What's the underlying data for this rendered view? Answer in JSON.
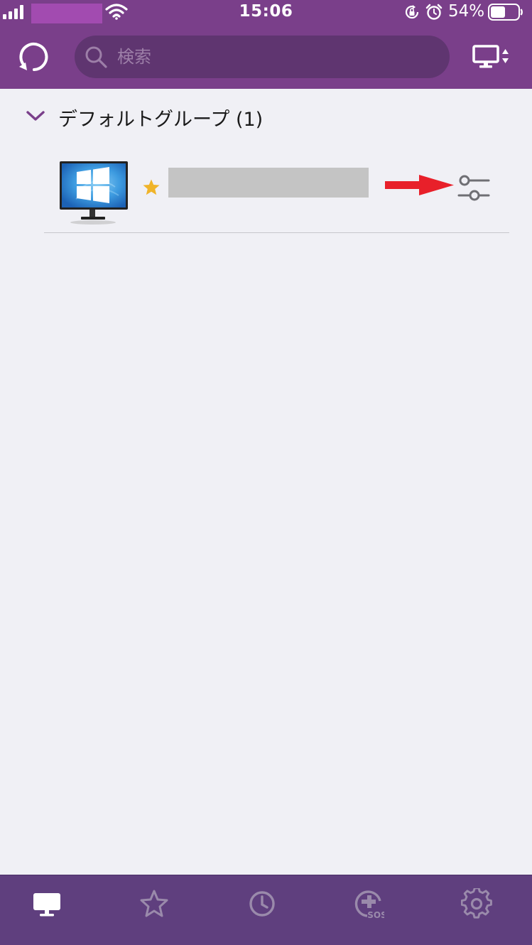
{
  "status_bar": {
    "time": "15:06",
    "battery_percent": "54%",
    "battery_level": 0.54
  },
  "navbar": {
    "search_placeholder": "検索"
  },
  "group": {
    "title": "デフォルトグループ (1)"
  },
  "device": {
    "favorite": true
  },
  "colors": {
    "brand_purple": "#7a3f8a",
    "tabbar_purple": "#5f3f7e",
    "star": "#f0b429",
    "annotation_red": "#e8202a"
  },
  "icons": {
    "refresh": "refresh-icon",
    "search": "search-icon",
    "device_switch": "device-switch-icon",
    "chevron": "chevron-down-icon",
    "monitor": "windows-monitor-icon",
    "star": "star-icon",
    "settings_sliders": "sliders-icon",
    "tabs": [
      "computer-icon",
      "star-icon",
      "clock-icon",
      "sos-icon",
      "gear-icon"
    ]
  },
  "tabbar": {
    "active_index": 0
  }
}
